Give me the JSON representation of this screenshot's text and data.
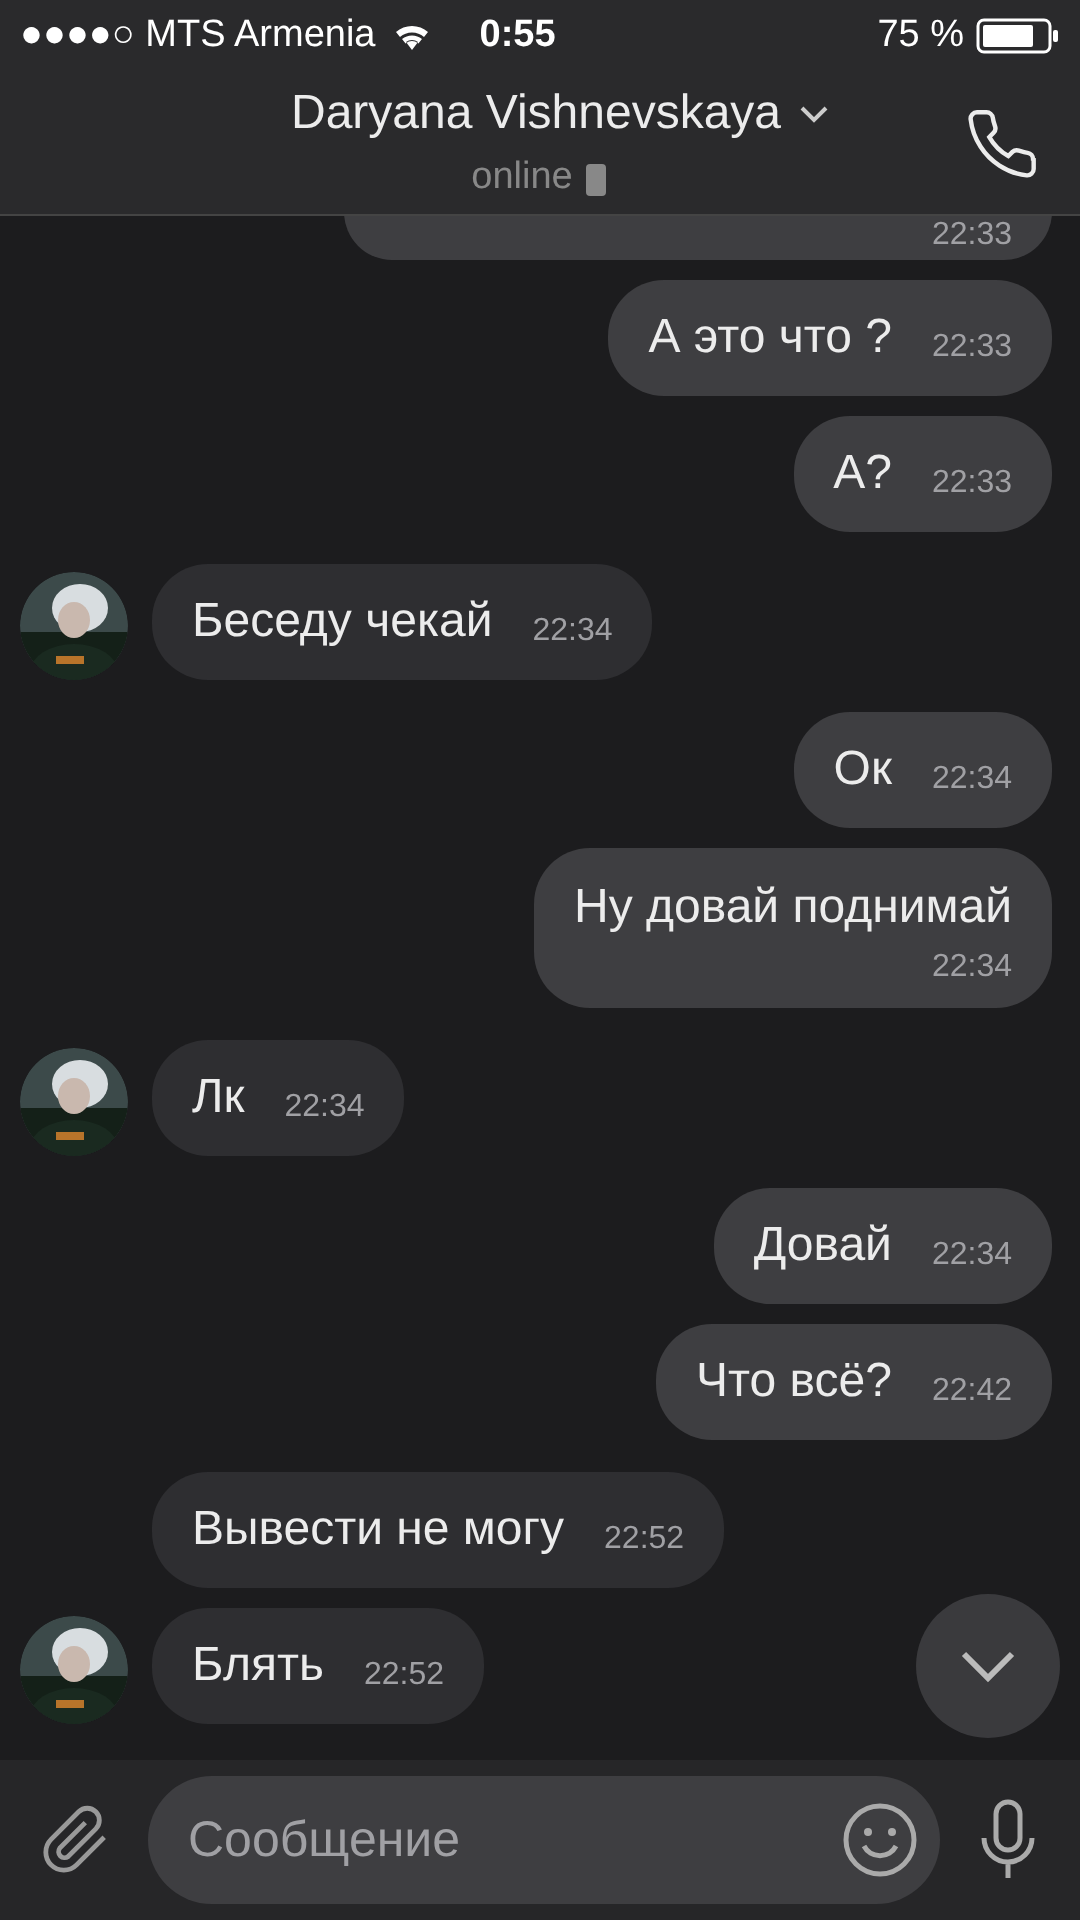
{
  "status_bar": {
    "carrier": "●●●●○ MTS Armenia",
    "time": "0:55",
    "battery": "75 %"
  },
  "header": {
    "name": "Daryana Vishnevskaya",
    "presence": "online"
  },
  "messages": [
    {
      "outgoing": true,
      "kind": "partial",
      "time": "22:33"
    },
    {
      "outgoing": true,
      "text": "А это что ?",
      "time": "22:33"
    },
    {
      "outgoing": true,
      "text": "А?",
      "time": "22:33"
    },
    {
      "outgoing": false,
      "avatar": true,
      "text": "Беседу чекай",
      "time": "22:34"
    },
    {
      "outgoing": true,
      "text": "Ок",
      "time": "22:34"
    },
    {
      "outgoing": true,
      "kind": "stacked",
      "text": "Ну довай поднимай",
      "time": "22:34"
    },
    {
      "outgoing": false,
      "avatar": true,
      "text": "Лк",
      "time": "22:34"
    },
    {
      "outgoing": true,
      "text": "Довай",
      "time": "22:34"
    },
    {
      "outgoing": true,
      "text": "Что всё?",
      "time": "22:42"
    },
    {
      "outgoing": false,
      "avatar": false,
      "text": "Вывести не могу",
      "time": "22:52"
    },
    {
      "outgoing": false,
      "avatar": true,
      "text": "Блять",
      "time": "22:52"
    }
  ],
  "composer": {
    "placeholder": "Сообщение"
  }
}
